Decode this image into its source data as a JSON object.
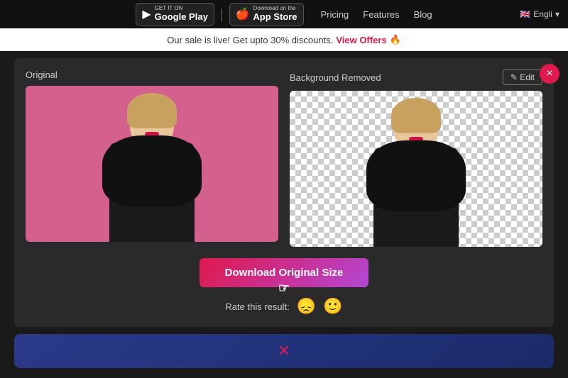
{
  "nav": {
    "google_play_top": "GET IT ON",
    "google_play_main": "Google Play",
    "app_store_top": "Download on the",
    "app_store_main": "App Store",
    "divider": "|",
    "links": [
      "Pricing",
      "Features",
      "Blog"
    ],
    "language": "Engli"
  },
  "promo": {
    "text": "Our sale is live! Get upto 30% discounts.",
    "cta": "View Offers",
    "emoji": "🔥"
  },
  "close_btn": "×",
  "panels": {
    "original_label": "Original",
    "bg_removed_label": "Background Removed",
    "edit_label": "✎ Edit"
  },
  "download": {
    "btn_label": "Download Original Size"
  },
  "rate": {
    "label": "Rate this result:",
    "sad_emoji": "😞",
    "happy_emoji": "🙂"
  }
}
